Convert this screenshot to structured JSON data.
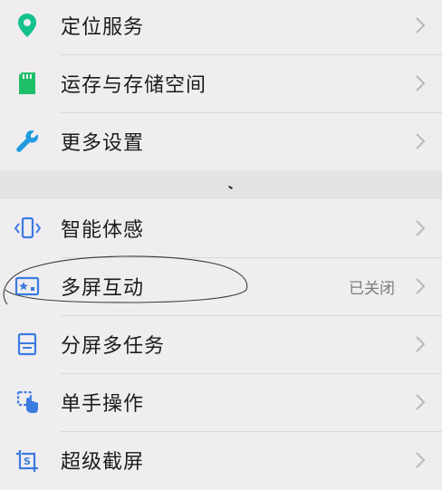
{
  "colors": {
    "location_icon": "#15c18f",
    "storage_icon": "#1fbf6a",
    "wrench_icon": "#1f9be0",
    "blue_icon": "#3a7be0",
    "chevron": "#b8b8bb"
  },
  "group1": [
    {
      "label": "定位服务",
      "icon": "location-pin-icon"
    },
    {
      "label": "运存与存储空间",
      "icon": "sd-card-icon"
    },
    {
      "label": "更多设置",
      "icon": "wrench-icon"
    }
  ],
  "group2": [
    {
      "label": "智能体感",
      "icon": "phone-motion-icon"
    },
    {
      "label": "多屏互动",
      "value": "已关闭",
      "icon": "screen-cast-icon"
    },
    {
      "label": "分屏多任务",
      "icon": "split-screen-icon"
    },
    {
      "label": "单手操作",
      "icon": "one-hand-icon"
    },
    {
      "label": "超级截屏",
      "icon": "screenshot-icon"
    }
  ]
}
